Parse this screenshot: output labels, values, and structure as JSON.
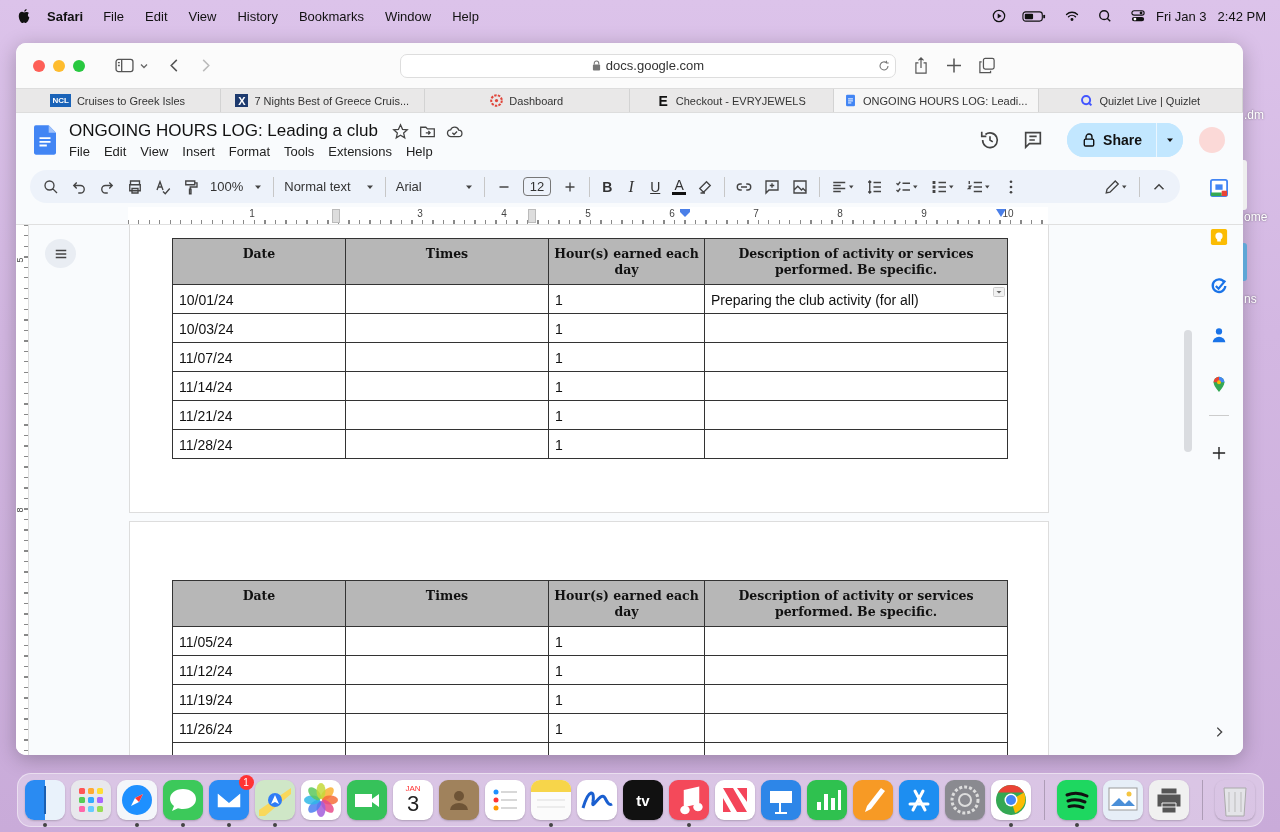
{
  "menubar": {
    "app": "Safari",
    "menus": [
      "File",
      "Edit",
      "View",
      "History",
      "Bookmarks",
      "Window",
      "Help"
    ],
    "date": "Fri Jan 3",
    "time": "2:42 PM"
  },
  "desktop_labels": [
    ".dm",
    "ome",
    "ns"
  ],
  "browser": {
    "address": "docs.google.com",
    "tabs": [
      {
        "label": "Cruises to Greek Isles",
        "kind": "text",
        "icon_text": "NCL",
        "selected": false
      },
      {
        "label": "7 Nights Best of Greece Cruis...",
        "kind": "text",
        "icon_text": "X",
        "selected": false
      },
      {
        "label": "Dashboard",
        "kind": "dashboard",
        "selected": false
      },
      {
        "label": "Checkout - EVRYJEWELS",
        "kind": "text",
        "icon_text": "E",
        "selected": false
      },
      {
        "label": "ONGOING HOURS LOG: Leadi...",
        "kind": "docs",
        "selected": true
      },
      {
        "label": "Quizlet Live | Quizlet",
        "kind": "quizlet",
        "selected": false
      }
    ]
  },
  "doc": {
    "title": "ONGOING HOURS LOG: Leading a club",
    "menus": [
      "File",
      "Edit",
      "View",
      "Insert",
      "Format",
      "Tools",
      "Extensions",
      "Help"
    ],
    "share": "Share",
    "toolbar": {
      "zoom": "100%",
      "style": "Normal text",
      "font": "Arial",
      "size": "12",
      "format": [
        "B",
        "I",
        "U",
        "A"
      ]
    },
    "ruler": [
      "1",
      "3",
      "4",
      "5",
      "6",
      "7",
      "8",
      "9",
      "10"
    ],
    "vertical_ruler": [
      "5",
      "8"
    ],
    "pages": [
      {
        "columns": [
          "Date",
          "Times",
          "Hour(s) earned each day",
          "Description of activity or services performed. Be specific."
        ],
        "rows": [
          {
            "date": "10/01/24",
            "hours": "1",
            "description": "Preparing the club activity (for all)",
            "cell_menu": true
          },
          {
            "date": "10/03/24",
            "hours": "1",
            "cell_menu": false
          },
          {
            "date": "11/07/24",
            "hours": "1",
            "cell_menu": false
          },
          {
            "date": "11/14/24",
            "hours": "1",
            "cell_menu": false
          },
          {
            "date": "11/21/24",
            "hours": "1",
            "cell_menu": false
          },
          {
            "date": "11/28/24",
            "hours": "1",
            "cell_menu": false
          }
        ]
      },
      {
        "columns": [
          "Date",
          "Times",
          "Hour(s) earned each day",
          "Description of activity or services performed. Be specific."
        ],
        "rows": [
          {
            "date": "11/05/24",
            "hours": "1",
            "cell_menu": false
          },
          {
            "date": "11/12/24",
            "hours": "1",
            "cell_menu": false
          },
          {
            "date": "11/19/24",
            "hours": "1",
            "cell_menu": false
          },
          {
            "date": "11/26/24",
            "hours": "1",
            "cell_menu": false
          }
        ]
      }
    ]
  },
  "dock": [
    {
      "kind": "finder",
      "running": true
    },
    {
      "kind": "launchpad",
      "running": false
    },
    {
      "kind": "safari",
      "running": true
    },
    {
      "kind": "messages",
      "running": true
    },
    {
      "kind": "mail",
      "running": true,
      "badge": "1"
    },
    {
      "kind": "maps",
      "running": true
    },
    {
      "kind": "photos",
      "running": false
    },
    {
      "kind": "facetime",
      "running": false
    },
    {
      "kind": "calendar",
      "running": false,
      "month": "JAN",
      "day": "3"
    },
    {
      "kind": "contacts",
      "running": false
    },
    {
      "kind": "reminders",
      "running": false
    },
    {
      "kind": "notes",
      "running": true
    },
    {
      "kind": "freeform",
      "running": false
    },
    {
      "kind": "tv",
      "running": false,
      "label": "tv"
    },
    {
      "kind": "music",
      "running": true
    },
    {
      "kind": "news",
      "running": false
    },
    {
      "kind": "keynote",
      "running": false
    },
    {
      "kind": "numbers",
      "running": false
    },
    {
      "kind": "pages",
      "running": false
    },
    {
      "kind": "appstore",
      "running": false
    },
    {
      "kind": "settings",
      "running": false
    },
    {
      "kind": "chrome",
      "running": true
    },
    {
      "kind": "separator"
    },
    {
      "kind": "spotify",
      "running": true
    },
    {
      "kind": "preview",
      "running": false
    },
    {
      "kind": "printer",
      "running": false
    },
    {
      "kind": "separator"
    },
    {
      "kind": "trash",
      "running": false
    }
  ]
}
